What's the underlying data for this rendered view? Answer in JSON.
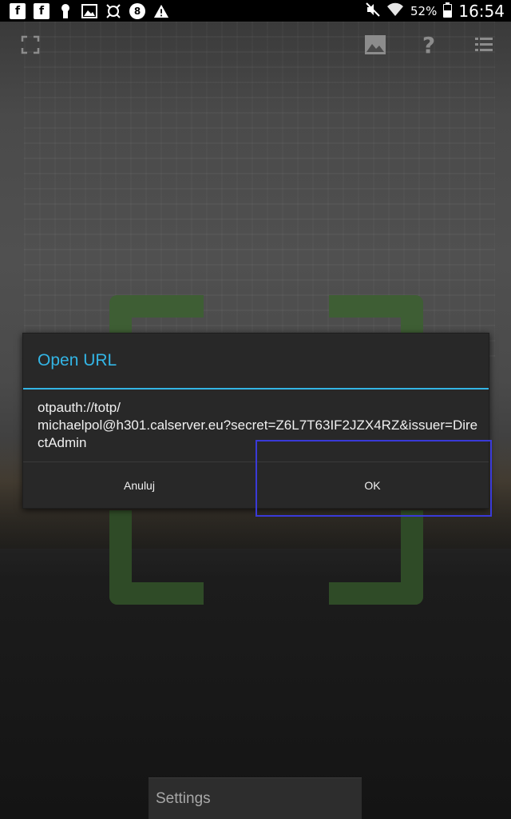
{
  "status_bar": {
    "notification_icons": [
      "facebook-icon",
      "facebook-icon",
      "keyhole-icon",
      "image-icon",
      "avast-icon",
      "eight-ball-icon",
      "warning-icon"
    ],
    "battery_percent": "52%",
    "battery_level": 0.52,
    "time": "16:54"
  },
  "toolbar": {
    "icons": [
      "fullscreen-icon",
      "gallery-icon",
      "help-icon",
      "history-icon"
    ],
    "help_glyph": "?"
  },
  "dialog": {
    "title": "Open URL",
    "message": "otpauth://totp/\nmichaelpol@h301.calserver.eu?secret=Z6L7T63IF2JZX4RZ&issuer=DirectAdmin",
    "cancel_label": "Anuluj",
    "ok_label": "OK"
  },
  "bottom_menu": {
    "settings_label": "Settings"
  },
  "colors": {
    "accent": "#33b5e5",
    "dialog_bg": "#282828",
    "highlight": "#3a3ad8"
  }
}
